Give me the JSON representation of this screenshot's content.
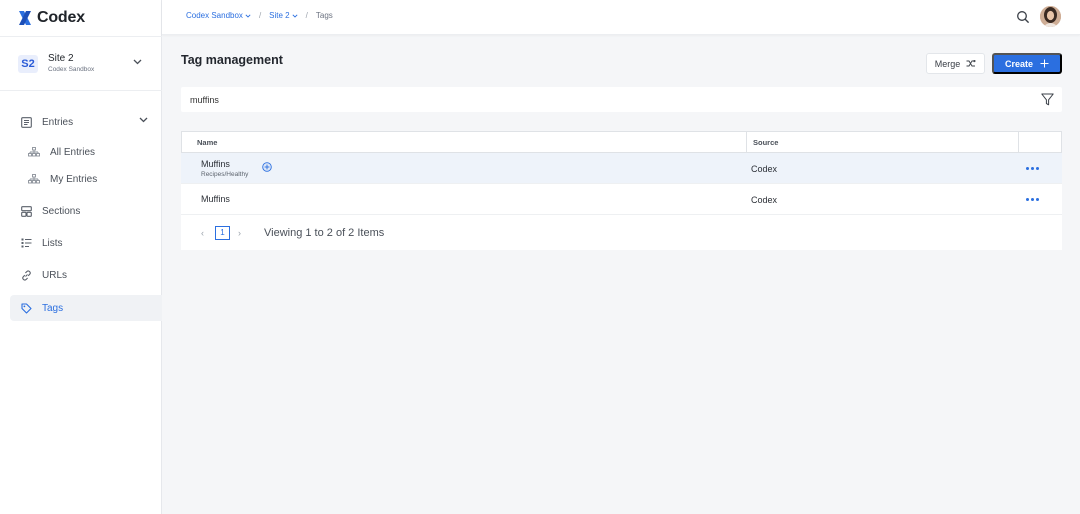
{
  "app": {
    "name": "Codex",
    "logo_color": "#2b6fe0"
  },
  "site": {
    "badge": "S2",
    "name": "Site 2",
    "org": "Codex Sandbox"
  },
  "sidebar": {
    "items": [
      {
        "label": "Entries",
        "icon": "entries-icon"
      },
      {
        "label": "All Entries",
        "icon": "hierarchy-icon"
      },
      {
        "label": "My Entries",
        "icon": "hierarchy-icon"
      },
      {
        "label": "Sections",
        "icon": "sections-icon"
      },
      {
        "label": "Lists",
        "icon": "lists-icon"
      },
      {
        "label": "URLs",
        "icon": "link-icon"
      },
      {
        "label": "Tags",
        "icon": "tag-icon",
        "active": true
      }
    ]
  },
  "breadcrumb": {
    "org": "Codex Sandbox",
    "site": "Site 2",
    "current": "Tags",
    "sep": "/"
  },
  "page": {
    "title": "Tag management"
  },
  "actions": {
    "merge_label": "Merge",
    "create_label": "Create"
  },
  "search": {
    "value": "muffins",
    "placeholder": ""
  },
  "table": {
    "columns": {
      "name": "Name",
      "source": "Source"
    },
    "rows": [
      {
        "name": "Muffins",
        "path": "Recipes/Healthy",
        "source": "Codex"
      },
      {
        "name": "Muffins",
        "path": "",
        "source": "Codex"
      }
    ]
  },
  "pagination": {
    "page": "1",
    "info": "Viewing 1 to 2 of 2 Items"
  },
  "colors": {
    "accent": "#2b6fe0",
    "active_bg": "#f0f2f5",
    "row_highlight": "#eef3fa"
  }
}
